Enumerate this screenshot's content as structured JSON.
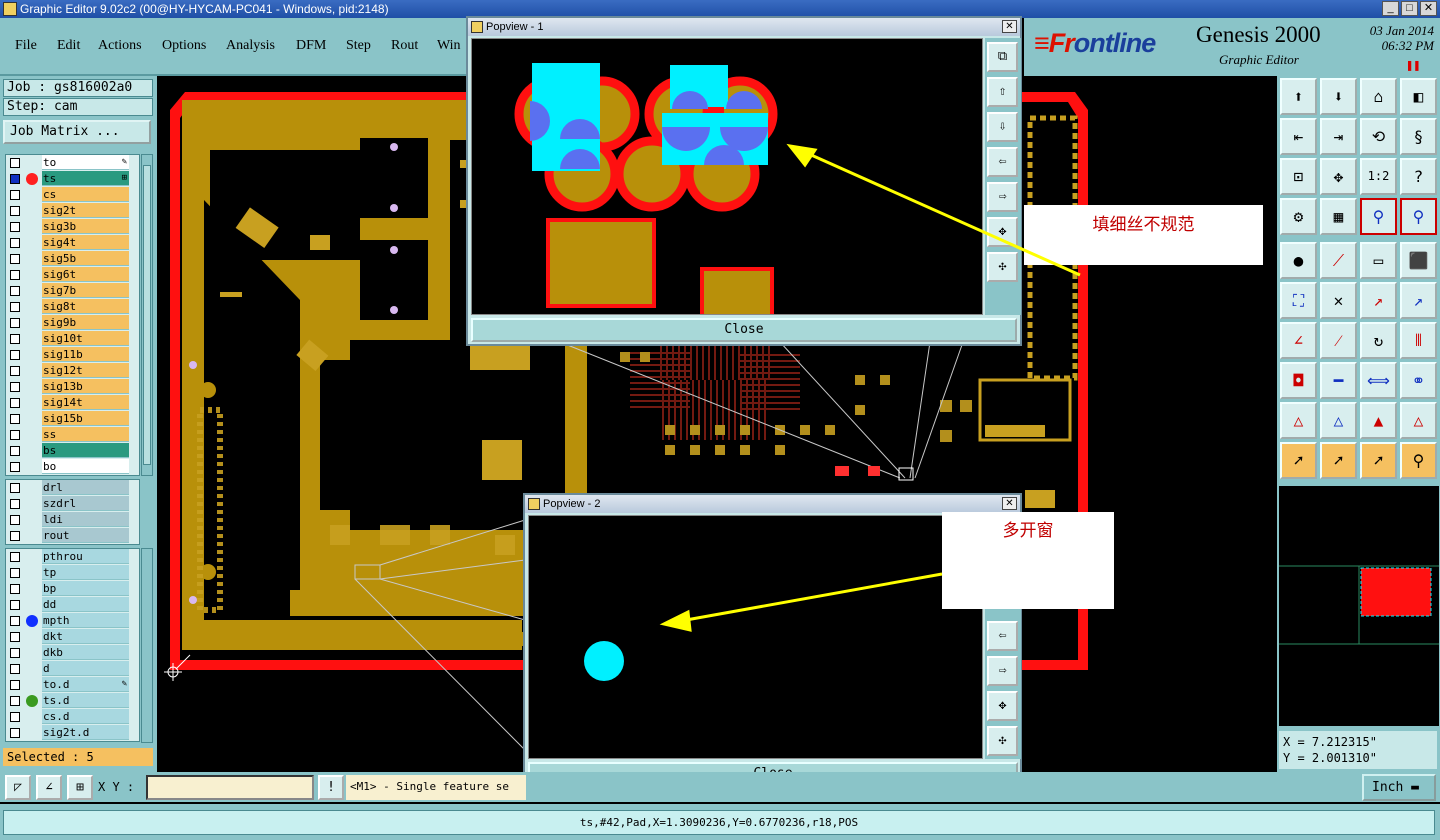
{
  "window": {
    "title": "Graphic Editor 9.02c2 (00@HY-HYCAM-PC041 - Windows, pid:2148)",
    "min": "_",
    "max": "□",
    "close": "✕"
  },
  "menu": [
    "File",
    "Edit",
    "Actions",
    "Options",
    "Analysis",
    "DFM",
    "Step",
    "Rout",
    "Win"
  ],
  "brand": {
    "logo_a": "≡Fr",
    "logo_b": "ontline",
    "product": "Genesis 2000",
    "subtitle": "Graphic Editor",
    "date": "03 Jan 2014",
    "time": "06:32 PM",
    "pause": "❚❚"
  },
  "job": {
    "job_label": "Job : gs816002a0",
    "step_label": "Step: cam",
    "matrix_button": "Job Matrix ..."
  },
  "layers_board": [
    {
      "name": "to",
      "color": "#ffffff",
      "tag": "✎"
    },
    {
      "name": "ts",
      "color": "#2a9a80",
      "tag": "⊞",
      "active": true,
      "marker": "#ff2020"
    },
    {
      "name": "cs",
      "color": "#f5c060"
    },
    {
      "name": "sig2t",
      "color": "#f5c060"
    },
    {
      "name": "sig3b",
      "color": "#f5c060"
    },
    {
      "name": "sig4t",
      "color": "#f5c060"
    },
    {
      "name": "sig5b",
      "color": "#f5c060"
    },
    {
      "name": "sig6t",
      "color": "#f5c060"
    },
    {
      "name": "sig7b",
      "color": "#f5c060"
    },
    {
      "name": "sig8t",
      "color": "#f5c060"
    },
    {
      "name": "sig9b",
      "color": "#f5c060"
    },
    {
      "name": "sig10t",
      "color": "#f5c060"
    },
    {
      "name": "sig11b",
      "color": "#f5c060"
    },
    {
      "name": "sig12t",
      "color": "#f5c060"
    },
    {
      "name": "sig13b",
      "color": "#f5c060"
    },
    {
      "name": "sig14t",
      "color": "#f5c060"
    },
    {
      "name": "sig15b",
      "color": "#f5c060"
    },
    {
      "name": "ss",
      "color": "#f5c060"
    },
    {
      "name": "bs",
      "color": "#2a9a80"
    },
    {
      "name": "bo",
      "color": "#ffffff"
    }
  ],
  "layers_drill": [
    {
      "name": "drl",
      "color": "#a8c8d0"
    },
    {
      "name": "szdrl",
      "color": "#a8c8d0"
    },
    {
      "name": "ldi",
      "color": "#a8c8d0"
    },
    {
      "name": "rout",
      "color": "#a8c8d0"
    }
  ],
  "layers_misc": [
    {
      "name": "pthrou",
      "color": "#a8d8e0"
    },
    {
      "name": "tp",
      "color": "#a8d8e0"
    },
    {
      "name": "bp",
      "color": "#a8d8e0"
    },
    {
      "name": "dd",
      "color": "#a8d8e0"
    },
    {
      "name": "mpth",
      "color": "#a8d8e0",
      "marker": "#1030ff"
    },
    {
      "name": "dkt",
      "color": "#a8d8e0"
    },
    {
      "name": "dkb",
      "color": "#a8d8e0"
    },
    {
      "name": "d",
      "color": "#a8d8e0"
    },
    {
      "name": "to.d",
      "color": "#a8d8e0",
      "tag": "✎"
    },
    {
      "name": "ts.d",
      "color": "#a8d8e0",
      "marker": "#3a9a20"
    },
    {
      "name": "cs.d",
      "color": "#a8d8e0"
    },
    {
      "name": "sig2t.d",
      "color": "#a8d8e0"
    }
  ],
  "selected": "Selected : 5",
  "popup1": {
    "title": "Popview - 1",
    "close_label": "Close"
  },
  "popup2": {
    "title": "Popview - 2",
    "close_label": "Close"
  },
  "annotation1": "填细丝不规范",
  "annotation2": "多开窗",
  "coords": {
    "x": "X = 7.212315\"",
    "y": "Y = 2.001310\""
  },
  "bottom": {
    "xy_label": "X Y :",
    "message": "<M1> - Single feature se",
    "unit": "Inch"
  },
  "status": "ts,#42,Pad,X=1.3090236,Y=0.6770236,r18,POS",
  "colors": {
    "copper": "#b8900a",
    "outline": "#ff1010",
    "cyan": "#00f0ff",
    "annotation_arrow": "#ffff00"
  }
}
